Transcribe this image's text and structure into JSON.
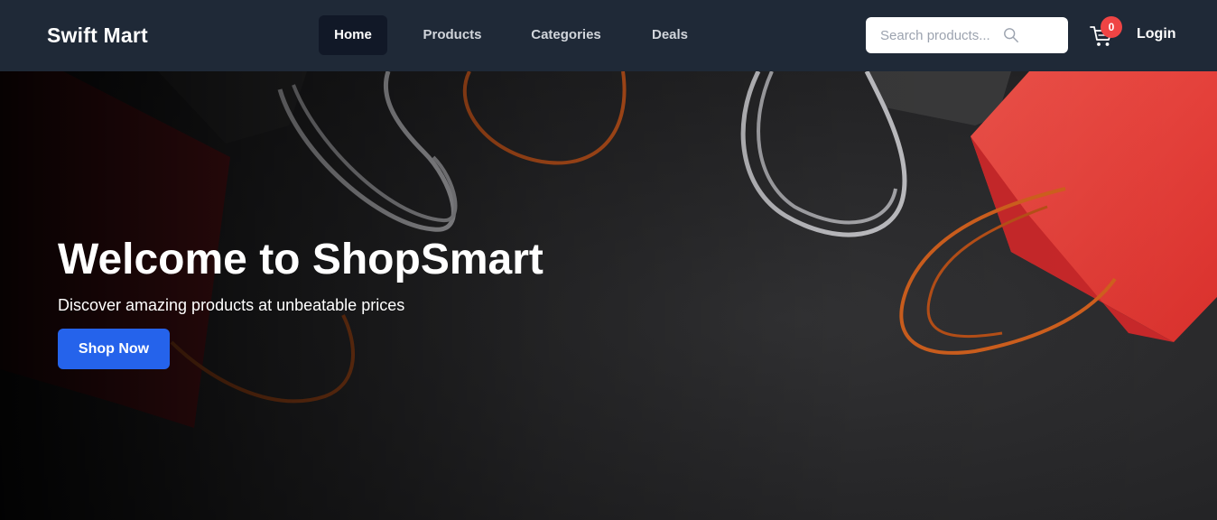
{
  "header": {
    "brand": "Swift Mart",
    "nav": [
      {
        "label": "Home",
        "active": true
      },
      {
        "label": "Products",
        "active": false
      },
      {
        "label": "Categories",
        "active": false
      },
      {
        "label": "Deals",
        "active": false
      }
    ],
    "search": {
      "placeholder": "Search products...",
      "value": "",
      "icon": "search-icon"
    },
    "cart": {
      "icon": "cart-icon",
      "count": "0"
    },
    "login_label": "Login"
  },
  "hero": {
    "title": "Welcome to ShopSmart",
    "subtitle": "Discover amazing products at unbeatable prices",
    "cta_label": "Shop Now",
    "background": "shopping-bags-photo"
  },
  "colors": {
    "navbar": "#1f2937",
    "active_nav": "#111827",
    "accent": "#2563eb",
    "badge": "#ef4444"
  }
}
